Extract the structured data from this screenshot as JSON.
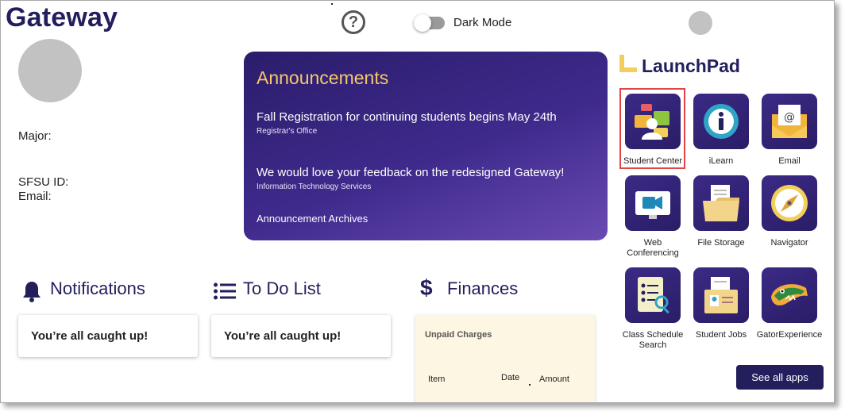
{
  "header": {
    "brand": "Gateway",
    "help_icon": "question-circle-icon",
    "dark_mode_label": "Dark Mode",
    "dark_mode_on": false
  },
  "profile": {
    "major_label": "Major:",
    "sfsu_id_label": "SFSU ID:",
    "email_label": "Email:"
  },
  "announcements": {
    "title": "Announcements",
    "items": [
      {
        "headline": "Fall Registration for continuing students begins May 24th",
        "source": "Registrar's Office"
      },
      {
        "headline": "We would love your feedback on the redesigned Gateway!",
        "source": "Information Technology Services"
      }
    ],
    "archives_link": "Announcement Archives"
  },
  "launchpad": {
    "title": "LaunchPad",
    "apps": [
      {
        "label": "Student Center",
        "icon": "student-center-icon"
      },
      {
        "label": "iLearn",
        "icon": "ilearn-info-icon"
      },
      {
        "label": "Email",
        "icon": "email-envelope-icon"
      },
      {
        "label": "Web Conferencing",
        "icon": "video-camera-icon"
      },
      {
        "label": "File Storage",
        "icon": "folder-icon"
      },
      {
        "label": "Navigator",
        "icon": "compass-icon"
      },
      {
        "label": "Class Schedule Search",
        "icon": "schedule-search-icon"
      },
      {
        "label": "Student Jobs",
        "icon": "id-card-folder-icon"
      },
      {
        "label": "GatorExperience",
        "icon": "gator-icon"
      }
    ],
    "see_all": "See all apps"
  },
  "notifications": {
    "title": "Notifications",
    "message": "You’re all caught up!",
    "icon": "bell-icon"
  },
  "todo": {
    "title": "To Do List",
    "message": "You’re all caught up!",
    "icon": "list-icon"
  },
  "finances": {
    "title": "Finances",
    "icon": "dollar-icon",
    "panel_title": "Unpaid Charges",
    "columns": [
      "Item",
      "Date",
      "Amount"
    ]
  },
  "colors": {
    "brand_navy": "#231f5c",
    "announcement_gold": "#f5c96a",
    "launchpad_yellow": "#f2cf5b",
    "highlight_red": "#e04646",
    "finance_panel_bg": "#fdf6e3"
  }
}
